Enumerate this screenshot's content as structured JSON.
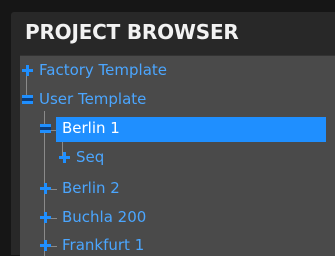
{
  "panel": {
    "title": "PROJECT BROWSER"
  },
  "tree": {
    "items": [
      {
        "label": "Factory Template",
        "expanded": false,
        "level": 0
      },
      {
        "label": "User Template",
        "expanded": true,
        "level": 0
      },
      {
        "label": "Berlin 1",
        "expanded": true,
        "level": 1,
        "selected": true
      },
      {
        "label": "Seq",
        "expanded": false,
        "level": 2
      },
      {
        "label": "Berlin 2",
        "expanded": false,
        "level": 1
      },
      {
        "label": "Buchla 200",
        "expanded": false,
        "level": 1
      },
      {
        "label": "Frankfurt 1",
        "expanded": false,
        "level": 1
      }
    ]
  },
  "colors": {
    "accent": "#1f8fff",
    "item_text": "#4ba6ff",
    "selected_text": "#ffffff",
    "toggle_icon": "#1f8fff",
    "panel_bg": "#4a4a4a",
    "header_bg": "#282828",
    "title_text": "#f2f2f2"
  }
}
